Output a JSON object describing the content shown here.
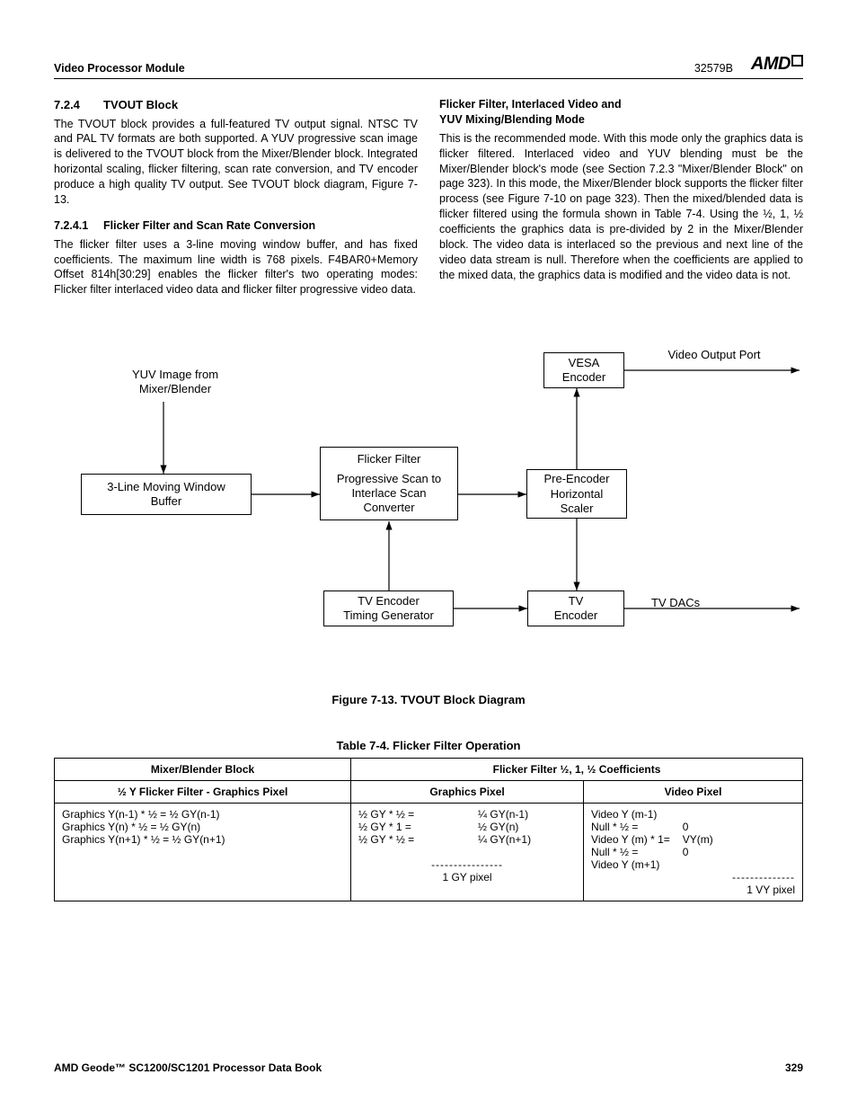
{
  "header": {
    "left": "Video Processor Module",
    "docnum": "32579B",
    "logo": "AMD"
  },
  "left_col": {
    "h4_num": "7.2.4",
    "h4_title": "TVOUT Block",
    "p1": "The TVOUT block provides a full-featured TV output signal. NTSC TV and PAL TV formats are both supported. A YUV progressive scan image is delivered to the TVOUT block from the Mixer/Blender block. Integrated horizontal scaling, flicker filtering, scan rate conversion, and TV encoder produce a high quality TV output. See TVOUT block diagram, Figure 7-13.",
    "h5_num": "7.2.4.1",
    "h5_title": "Flicker Filter and Scan Rate Conversion",
    "p2": "The flicker filter uses a 3-line moving window buffer, and has fixed coefficients. The maximum line width is 768 pixels. F4BAR0+Memory Offset 814h[30:29] enables the flicker filter's two operating modes: Flicker filter interlaced video data and flicker filter progressive video data."
  },
  "right_col": {
    "sub1": "Flicker Filter, Interlaced Video and",
    "sub2": "YUV Mixing/Blending Mode",
    "p1": "This is the recommended mode. With this mode only the graphics data is flicker filtered. Interlaced video and YUV blending must be the Mixer/Blender block's mode (see Section 7.2.3 \"Mixer/Blender Block\" on page 323). In this mode, the Mixer/Blender block supports the flicker filter process (see Figure 7-10 on page 323). Then the mixed/blended data is flicker filtered using the formula shown in Table 7-4. Using the ½, 1, ½ coefficients the graphics data is pre-divided by 2 in the Mixer/Blender block. The video data is interlaced so the previous and next line of the video data stream is null. Therefore when the coefficients are applied to the mixed data, the graphics data is modified and the video data is not."
  },
  "diagram": {
    "yuv_label_l1": "YUV Image from",
    "yuv_label_l2": "Mixer/Blender",
    "box_buffer_l1": "3-Line Moving Window",
    "box_buffer_l2": "Buffer",
    "box_ff_l1": "Flicker Filter",
    "box_ff_l2": "Progressive Scan to",
    "box_ff_l3": "Interlace Scan",
    "box_ff_l4": "Converter",
    "box_scaler_l1": "Pre-Encoder",
    "box_scaler_l2": "Horizontal",
    "box_scaler_l3": "Scaler",
    "box_vesa_l1": "VESA",
    "box_vesa_l2": "Encoder",
    "vop_label": "Video Output Port",
    "box_timing_l1": "TV Encoder",
    "box_timing_l2": "Timing Generator",
    "box_tvenc_l1": "TV",
    "box_tvenc_l2": "Encoder",
    "tvdacs_label": "TV DACs"
  },
  "fig_caption": "Figure 7-13.  TVOUT Block Diagram",
  "tbl_caption": "Table 7-4.  Flicker Filter Operation",
  "table": {
    "h_mixer": "Mixer/Blender Block",
    "h_coeff": "Flicker Filter ½, 1, ½ Coefficients",
    "h_halfY": "½ Y Flicker Filter - Graphics Pixel",
    "h_gpx": "Graphics Pixel",
    "h_vpx": "Video Pixel",
    "c_mixer_l1": "Graphics Y(n-1) * ½ = ½ GY(n-1)",
    "c_mixer_l2": "Graphics Y(n) * ½ = ½ GY(n)",
    "c_mixer_l3": "Graphics Y(n+1) * ½ = ½ GY(n+1)",
    "c_g_l1a": "½ GY * ½ =",
    "c_g_l1b": "¼ GY(n-1)",
    "c_g_l2a": "½ GY * 1 =",
    "c_g_l2b": "½ GY(n)",
    "c_g_l3a": "½ GY * ½ =",
    "c_g_l3b": "¼ GY(n+1)",
    "c_g_dash": "----------------",
    "c_g_res": "1 GY pixel",
    "c_v_l1": "Video Y (m-1)",
    "c_v_l2a": "Null * ½  =",
    "c_v_l2b": "0",
    "c_v_l3a": "Video Y (m) * 1=",
    "c_v_l3b": "VY(m)",
    "c_v_l4a": "Null * ½  =",
    "c_v_l4b": "0",
    "c_v_l5": "Video Y (m+1)",
    "c_v_dash": "--------------",
    "c_v_res": "1 VY pixel"
  },
  "footer": {
    "left": "AMD Geode™ SC1200/SC1201 Processor Data Book",
    "right": "329"
  }
}
